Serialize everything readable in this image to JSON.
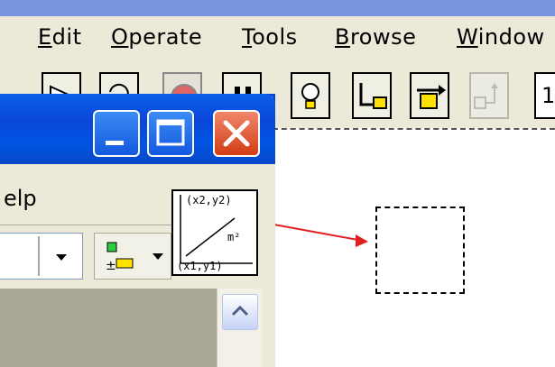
{
  "menubar": {
    "items": [
      {
        "label": "Edit"
      },
      {
        "label": "Operate"
      },
      {
        "label": "Tools"
      },
      {
        "label": "Browse"
      },
      {
        "label": "Window"
      }
    ]
  },
  "toolbar": {
    "run_number": "1"
  },
  "palette": {
    "menu_help": "elp",
    "line_tool": {
      "label_top": "(x2,y2)",
      "label_unit": "m²",
      "label_bottom": "(x1,y1)"
    }
  },
  "colors": {
    "titlebar_blue": "#0a46d8",
    "close_red": "#d23d14",
    "arrow_red": "#e02020",
    "canvas_bg": "#ffffff"
  }
}
